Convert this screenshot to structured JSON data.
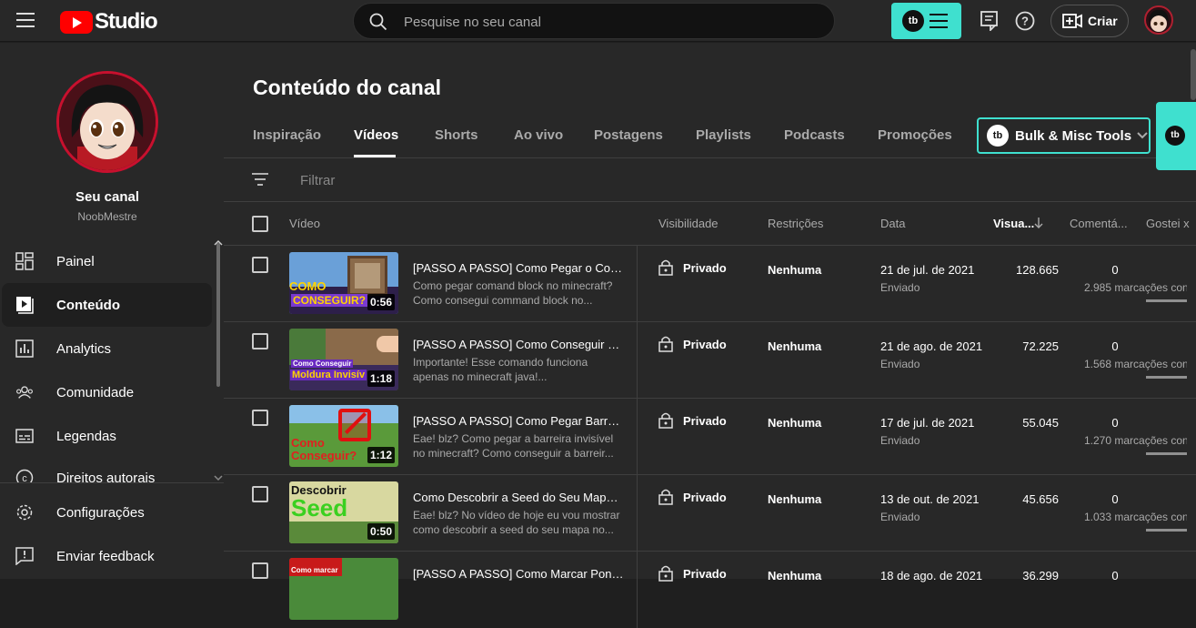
{
  "app": {
    "logo_text": "Studio",
    "search_placeholder": "Pesquise no seu canal",
    "create_label": "Criar",
    "tb_badge": "tb"
  },
  "channel": {
    "title": "Seu canal",
    "name": "NoobMestre"
  },
  "sidebar": {
    "items": [
      {
        "label": "Painel",
        "icon": "dashboard-icon"
      },
      {
        "label": "Conteúdo",
        "icon": "content-icon",
        "active": true
      },
      {
        "label": "Analytics",
        "icon": "analytics-icon"
      },
      {
        "label": "Comunidade",
        "icon": "community-icon"
      },
      {
        "label": "Legendas",
        "icon": "subtitles-icon"
      },
      {
        "label": "Direitos autorais",
        "icon": "copyright-icon"
      }
    ],
    "bottom": [
      {
        "label": "Configurações",
        "icon": "gear-icon"
      },
      {
        "label": "Enviar feedback",
        "icon": "feedback-icon"
      }
    ]
  },
  "main": {
    "title": "Conteúdo do canal",
    "tabs": [
      "Inspiração",
      "Vídeos",
      "Shorts",
      "Ao vivo",
      "Postagens",
      "Playlists",
      "Podcasts",
      "Promoções"
    ],
    "active_tab": "Vídeos",
    "bulk_label": "Bulk & Misc Tools",
    "filter_placeholder": "Filtrar",
    "columns": {
      "video": "Vídeo",
      "visibility": "Visibilidade",
      "restrictions": "Restrições",
      "date": "Data",
      "views": "Visua...",
      "comments": "Comentá...",
      "likes": "Gostei x"
    }
  },
  "videos": [
    {
      "title": "[PASSO A PASSO] Como Pegar o Com...",
      "desc1": "Como pegar comand block no minecraft?",
      "desc2": "Como consegui command block no...",
      "duration": "0:56",
      "visibility": "Privado",
      "restrictions": "Nenhuma",
      "date": "21 de jul. de 2021",
      "status": "Enviado",
      "views": "128.665",
      "comments": "0",
      "marks": "2.985 marcações con",
      "thumb_text1": "COMO",
      "thumb_text2": "CONSEGUIR?"
    },
    {
      "title": "[PASSO A PASSO] Como Conseguir M...",
      "desc1": "Importante! Esse comando funciona",
      "desc2": "apenas no minecraft java!...",
      "duration": "1:18",
      "visibility": "Privado",
      "restrictions": "Nenhuma",
      "date": "21 de ago. de 2021",
      "status": "Enviado",
      "views": "72.225",
      "comments": "0",
      "marks": "1.568 marcações con",
      "thumb_text1": "Como Conseguir",
      "thumb_text2": "Moldura Invisív"
    },
    {
      "title": "[PASSO A PASSO] Como Pegar Barreir...",
      "desc1": "Eae! blz? Como pegar a barreira invisível",
      "desc2": "no minecraft? Como conseguir a barreir...",
      "duration": "1:12",
      "visibility": "Privado",
      "restrictions": "Nenhuma",
      "date": "17 de jul. de 2021",
      "status": "Enviado",
      "views": "55.045",
      "comments": "0",
      "marks": "1.270 marcações con",
      "thumb_text1": "Como",
      "thumb_text2": "Conseguir?"
    },
    {
      "title": "Como Descobrir a Seed do Seu Mapa ...",
      "desc1": "Eae! blz? No vídeo de hoje eu vou mostrar",
      "desc2": "como descobrir a seed do seu mapa no...",
      "duration": "0:50",
      "visibility": "Privado",
      "restrictions": "Nenhuma",
      "date": "13 de out. de 2021",
      "status": "Enviado",
      "views": "45.656",
      "comments": "0",
      "marks": "1.033 marcações con",
      "thumb_text1": "Descobrir",
      "thumb_text2": "Seed"
    },
    {
      "title": "[PASSO A PASSO] Como Marcar Pont...",
      "desc1": "",
      "desc2": "",
      "duration": "",
      "visibility": "Privado",
      "restrictions": "Nenhuma",
      "date": "18 de ago. de 2021",
      "status": "",
      "views": "36.299",
      "comments": "0",
      "marks": "",
      "thumb_text1": "Como marcar",
      "thumb_text2": ""
    }
  ]
}
